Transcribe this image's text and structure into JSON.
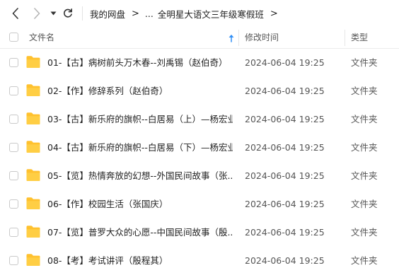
{
  "toolbar": {
    "back_icon": "chevron-left-icon",
    "forward_icon": "chevron-right-icon",
    "history_icon": "caret-down-icon",
    "refresh_icon": "refresh-icon"
  },
  "breadcrumb": {
    "root": "我的网盘",
    "separator": ">",
    "ellipsis": "...",
    "current": "全明星大语文三年级寒假班"
  },
  "columns": {
    "name": "文件名",
    "modified": "修改时间",
    "type": "类型",
    "sort_icon": "sort-ascending-arrow-icon",
    "accent_color": "#2f8ef5"
  },
  "folder_color": "#ffc12e",
  "files": [
    {
      "name": "01-【古】病树前头万木春--刘禹锡（赵伯奇）",
      "modified": "2024-06-04 19:25",
      "type": "文件夹"
    },
    {
      "name": "02-【作】修辞系列（赵伯奇）",
      "modified": "2024-06-04 19:25",
      "type": "文件夹"
    },
    {
      "name": "03-【古】新乐府的旗帜--白居易（上）—杨宏业",
      "modified": "2024-06-04 19:25",
      "type": "文件夹"
    },
    {
      "name": "04-【古】新乐府的旗帜--白居易（下）—杨宏业",
      "modified": "2024-06-04 19:25",
      "type": "文件夹"
    },
    {
      "name": "05-【览】热情奔放的幻想--外国民间故事（张...",
      "modified": "2024-06-04 19:25",
      "type": "文件夹"
    },
    {
      "name": "06-【作】校园生活（张国庆）",
      "modified": "2024-06-04 19:25",
      "type": "文件夹"
    },
    {
      "name": "07-【览】普罗大众的心愿--中国民间故事（殷...",
      "modified": "2024-06-04 19:25",
      "type": "文件夹"
    },
    {
      "name": "08-【考】考试讲评（殷程其）",
      "modified": "2024-06-04 19:25",
      "type": "文件夹"
    }
  ]
}
